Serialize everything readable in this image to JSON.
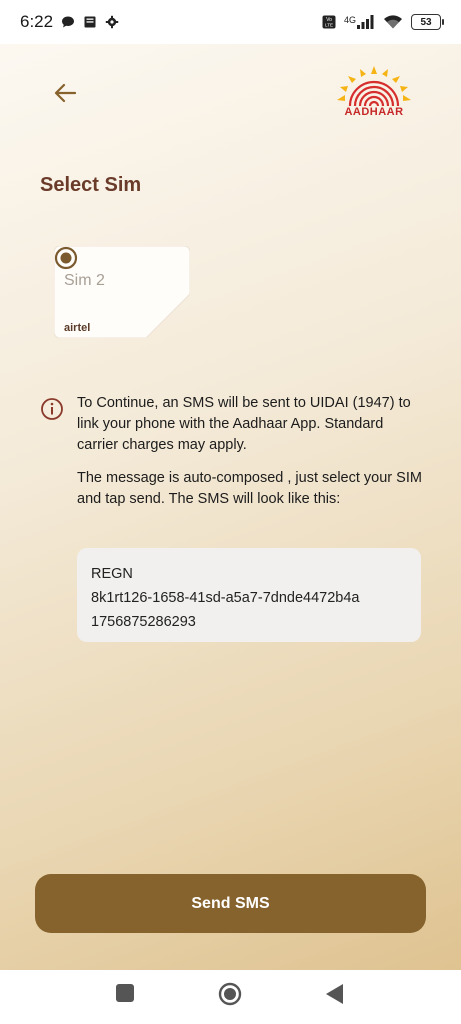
{
  "status_bar": {
    "time": "6:22",
    "network": "4G",
    "battery": "53",
    "icons": [
      "chat-bubble-icon",
      "notes-icon",
      "settings-gear-icon",
      "volte-icon",
      "signal-icon",
      "wifi-icon",
      "battery-icon"
    ]
  },
  "header": {
    "back_icon": "arrow-left-icon",
    "logo_text": "AADHAAR"
  },
  "page": {
    "title": "Select Sim"
  },
  "sim": {
    "name": "Sim 2",
    "carrier": "airtel",
    "selected": true
  },
  "info": {
    "icon": "info-circle-icon",
    "paragraph1": "To Continue, an SMS will be sent to UIDAI (1947) to link your phone with the Aadhaar App. Standard carrier charges may apply.",
    "paragraph2": "The message is auto-composed , just select your SIM and tap send. The SMS will look like this:"
  },
  "sms_preview": {
    "line1": "REGN",
    "line2": "8k1rt126-1658-41sd-a5a7-7dnde4472b4a",
    "line3": "1756875286293"
  },
  "actions": {
    "send_label": "Send SMS"
  },
  "colors": {
    "accent": "#86622c",
    "title": "#6b3b2a",
    "logo_red": "#c62828"
  }
}
